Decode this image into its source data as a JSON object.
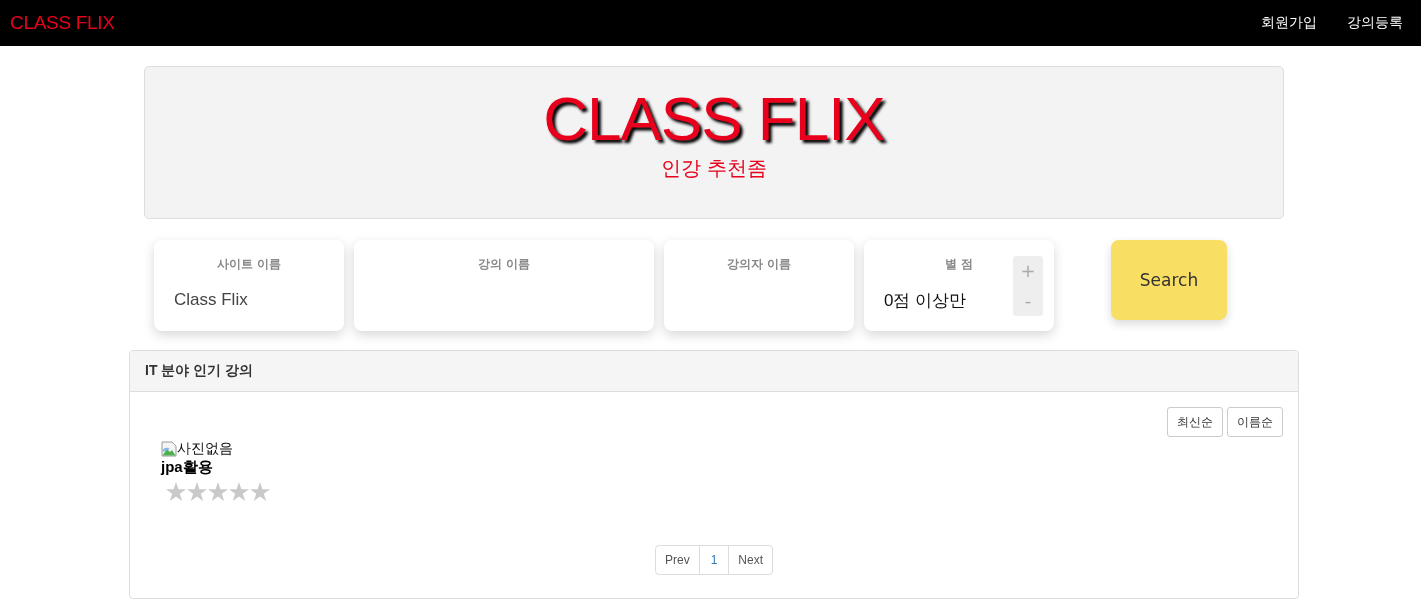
{
  "navbar": {
    "brand": "CLASS FLIX",
    "links": [
      "회원가입",
      "강의등록"
    ]
  },
  "hero": {
    "title": "CLASS FLIX",
    "subtitle": "인강 추천좀"
  },
  "filters": [
    {
      "kind": "text",
      "label": "사이트 이름",
      "value": "Class Flix"
    },
    {
      "kind": "text",
      "label": "강의 이름"
    },
    {
      "kind": "text",
      "label": "강의자 이름"
    },
    {
      "kind": "stepper",
      "label": "별 점",
      "value": "0점 이상만",
      "increment": "+",
      "decrement": "-"
    }
  ],
  "search_button": "Search",
  "panel": {
    "title": "IT 분야 인기 강의",
    "sort_buttons": [
      "최신순",
      "이름순"
    ],
    "courses": [
      {
        "image_alt": "사진없음",
        "title": "jpa활용",
        "stars": 0
      }
    ],
    "pagination": {
      "prev": "Prev",
      "pages": [
        "1"
      ],
      "next": "Next"
    }
  }
}
